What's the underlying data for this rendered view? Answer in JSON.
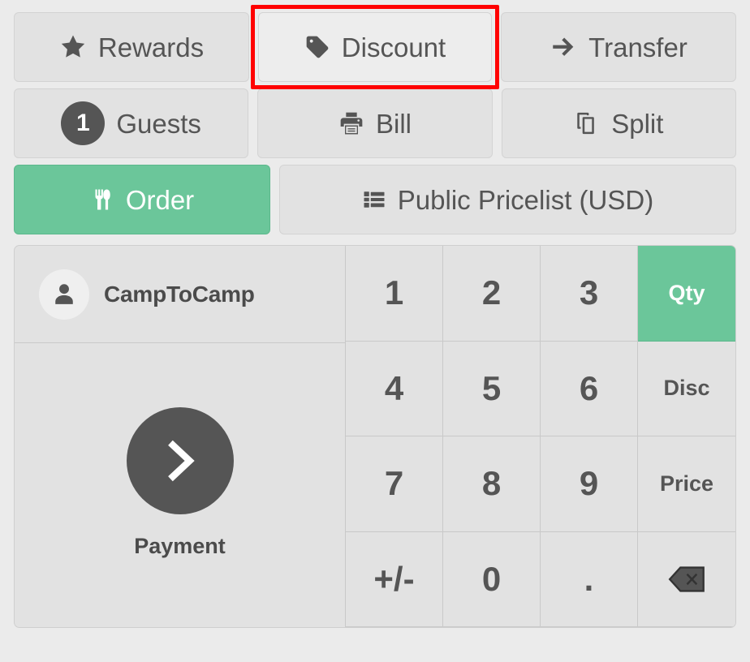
{
  "theme": {
    "background": "#ebebeb",
    "button_bg": "#e2e2e2",
    "button_border": "#d3d3d3",
    "text": "#555555",
    "accent_green": "#6bc69a",
    "dark": "#555555",
    "highlight_ring": "#ff0000"
  },
  "actions": {
    "row1": [
      {
        "label": "Rewards",
        "icon": "star-icon",
        "state": "default"
      },
      {
        "label": "Discount",
        "icon": "tag-icon",
        "state": "highlighted"
      },
      {
        "label": "Transfer",
        "icon": "arrow-right-icon",
        "state": "default"
      }
    ],
    "row2": [
      {
        "label": "Guests",
        "icon": "guest-count-badge",
        "badge": "1",
        "state": "default"
      },
      {
        "label": "Bill",
        "icon": "printer-icon",
        "state": "default"
      },
      {
        "label": "Split",
        "icon": "copy-icon",
        "state": "default"
      }
    ],
    "row3": [
      {
        "label": "Order",
        "icon": "cutlery-icon",
        "state": "primary"
      },
      {
        "label": "Public Pricelist (USD)",
        "icon": "list-icon",
        "state": "default"
      }
    ]
  },
  "order_panel": {
    "customer": {
      "name": "CampToCamp",
      "avatar_icon": "person-icon"
    },
    "payment": {
      "label": "Payment",
      "icon": "chevron-right-icon"
    }
  },
  "numpad": {
    "keys": [
      {
        "label": "1",
        "type": "digit",
        "state": "default"
      },
      {
        "label": "2",
        "type": "digit",
        "state": "default"
      },
      {
        "label": "3",
        "type": "digit",
        "state": "default"
      },
      {
        "label": "Qty",
        "type": "mode",
        "state": "active"
      },
      {
        "label": "4",
        "type": "digit",
        "state": "default"
      },
      {
        "label": "5",
        "type": "digit",
        "state": "default"
      },
      {
        "label": "6",
        "type": "digit",
        "state": "default"
      },
      {
        "label": "Disc",
        "type": "mode",
        "state": "default"
      },
      {
        "label": "7",
        "type": "digit",
        "state": "default"
      },
      {
        "label": "8",
        "type": "digit",
        "state": "default"
      },
      {
        "label": "9",
        "type": "digit",
        "state": "default"
      },
      {
        "label": "Price",
        "type": "mode",
        "state": "default"
      },
      {
        "label": "+/-",
        "type": "sign",
        "state": "default"
      },
      {
        "label": "0",
        "type": "digit",
        "state": "default"
      },
      {
        "label": ".",
        "type": "decimal",
        "state": "default"
      },
      {
        "label": "",
        "type": "backspace",
        "icon": "backspace-icon",
        "state": "default"
      }
    ]
  }
}
